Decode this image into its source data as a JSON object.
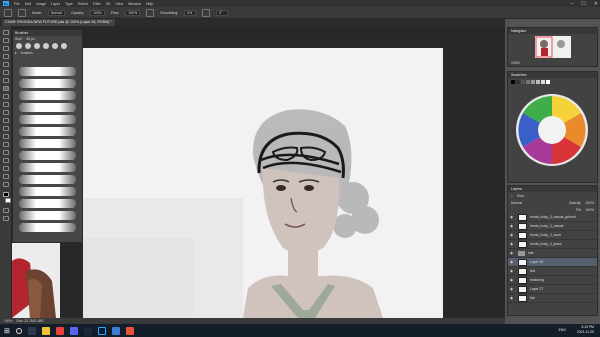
{
  "menubar": {
    "items": [
      "File",
      "Edit",
      "Image",
      "Layer",
      "Type",
      "Select",
      "Filter",
      "3D",
      "View",
      "Window",
      "Help"
    ]
  },
  "options": {
    "mode_label": "Mode:",
    "mode_value": "Normal",
    "opacity_label": "Opacity:",
    "opacity_value": "100%",
    "flow_label": "Flow:",
    "flow_value": "100%",
    "smoothing_label": "Smoothing:",
    "smoothing_value": "0%",
    "angle_value": "0°"
  },
  "document": {
    "tab_title": "CHAR: RHONDA NEW FUTURE.psd @ 100% (Layer 28, RGB/8) *"
  },
  "brushes_panel": {
    "title": "Brushes",
    "size_label": "Size:",
    "size_value": "60 px",
    "folder_name": "brushes"
  },
  "navigator": {
    "title": "Navigator",
    "zoom": "100%"
  },
  "swatches": {
    "title": "Swatches"
  },
  "layers_panel": {
    "title": "Layers",
    "kind_label": "Kind",
    "blend_mode": "Normal",
    "opacity_label": "Opacity:",
    "opacity_value": "100%",
    "fill_label": "Fill:",
    "fill_value": "100%",
    "layers": [
      {
        "name": "rhnda_body_3_casual_grdnnd",
        "kind": "layer",
        "selected": false
      },
      {
        "name": "rhnda_body_3_casual",
        "kind": "layer",
        "selected": false
      },
      {
        "name": "rhnda_body_3_worn",
        "kind": "layer",
        "selected": false
      },
      {
        "name": "rhnda_body_3_jeans",
        "kind": "layer",
        "selected": false
      },
      {
        "name": "hair",
        "kind": "group",
        "selected": false
      },
      {
        "name": "Layer 28",
        "kind": "layer",
        "selected": true
      },
      {
        "name": "line",
        "kind": "layer",
        "selected": false
      },
      {
        "name": "mutching",
        "kind": "layer",
        "selected": false
      },
      {
        "name": "Layer 27",
        "kind": "layer",
        "selected": false
      },
      {
        "name": "flat",
        "kind": "layer",
        "selected": false
      }
    ]
  },
  "status": {
    "zoom": "100%",
    "doc": "Doc: 23.7M/1.88G"
  },
  "taskbar": {
    "language": "ENG",
    "time": "3:10 PM",
    "date": "2021-11-29"
  },
  "colors": {
    "foreground": "#000000",
    "background": "#ffffff",
    "accent": "#31a8ff"
  }
}
